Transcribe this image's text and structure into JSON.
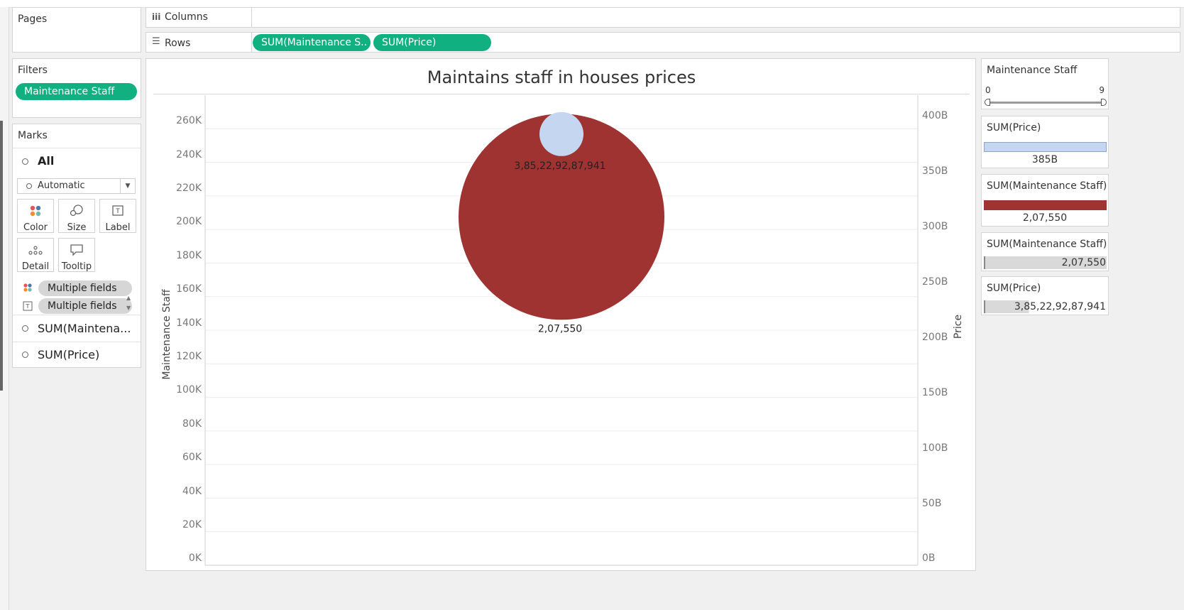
{
  "shelves": {
    "pages_label": "Pages",
    "columns_label": "Columns",
    "rows_label": "Rows",
    "rows_pills": [
      "SUM(Maintenance S..",
      "SUM(Price)"
    ]
  },
  "filters": {
    "label": "Filters",
    "pill": "Maintenance Staff"
  },
  "marks": {
    "label": "Marks",
    "all_label": "All",
    "mark_type": "Automatic",
    "buttons": {
      "color": "Color",
      "size": "Size",
      "label": "Label",
      "detail": "Detail",
      "tooltip": "Tooltip"
    },
    "field_pills": [
      "Multiple fields",
      "Multiple fields"
    ],
    "measure_rows": [
      "SUM(Maintena...",
      "SUM(Price)"
    ]
  },
  "colors": {
    "accent_green": "#10b081",
    "price_circle": "#c4d6f0",
    "staff_circle": "#9e3331"
  },
  "chart": {
    "title": "Maintains staff in houses prices",
    "left_axis_title": "Maintenance Staff",
    "right_axis_title": "Price",
    "left_ticks": [
      "0K",
      "20K",
      "40K",
      "60K",
      "80K",
      "100K",
      "120K",
      "140K",
      "160K",
      "180K",
      "200K",
      "220K",
      "240K",
      "260K"
    ],
    "right_ticks": [
      "0B",
      "50B",
      "100B",
      "150B",
      "200B",
      "250B",
      "300B",
      "350B",
      "400B"
    ],
    "data_label_price": "3,85,22,92,87,941",
    "data_label_staff": "2,07,550"
  },
  "chart_data": {
    "type": "scatter",
    "title": "Maintains staff in houses prices",
    "ylabel": "Maintenance Staff",
    "y2label": "Price",
    "ylim": [
      0,
      280000
    ],
    "y2lim": [
      0,
      420000000000
    ],
    "series": [
      {
        "name": "SUM(Maintenance Staff)",
        "values": [
          207550
        ],
        "axis": "left",
        "label": "2,07,550",
        "color": "#9e3331"
      },
      {
        "name": "SUM(Price)",
        "values": [
          385229287941
        ],
        "axis": "right",
        "label": "3,85,22,92,87,941",
        "color": "#c4d6f0"
      }
    ],
    "grid": true
  },
  "legends": {
    "filter_title": "Maintenance Staff",
    "filter_min": "0",
    "filter_max": "9",
    "price_size_title": "SUM(Price)",
    "price_size_value": "385B",
    "staff_size_title": "SUM(Maintenance Staff)",
    "staff_size_value": "2,07,550",
    "staff_color_title": "SUM(Maintenance Staff)",
    "staff_color_value": "2,07,550",
    "price_color_title": "SUM(Price)",
    "price_color_value": "3,85,22,92,87,941"
  }
}
